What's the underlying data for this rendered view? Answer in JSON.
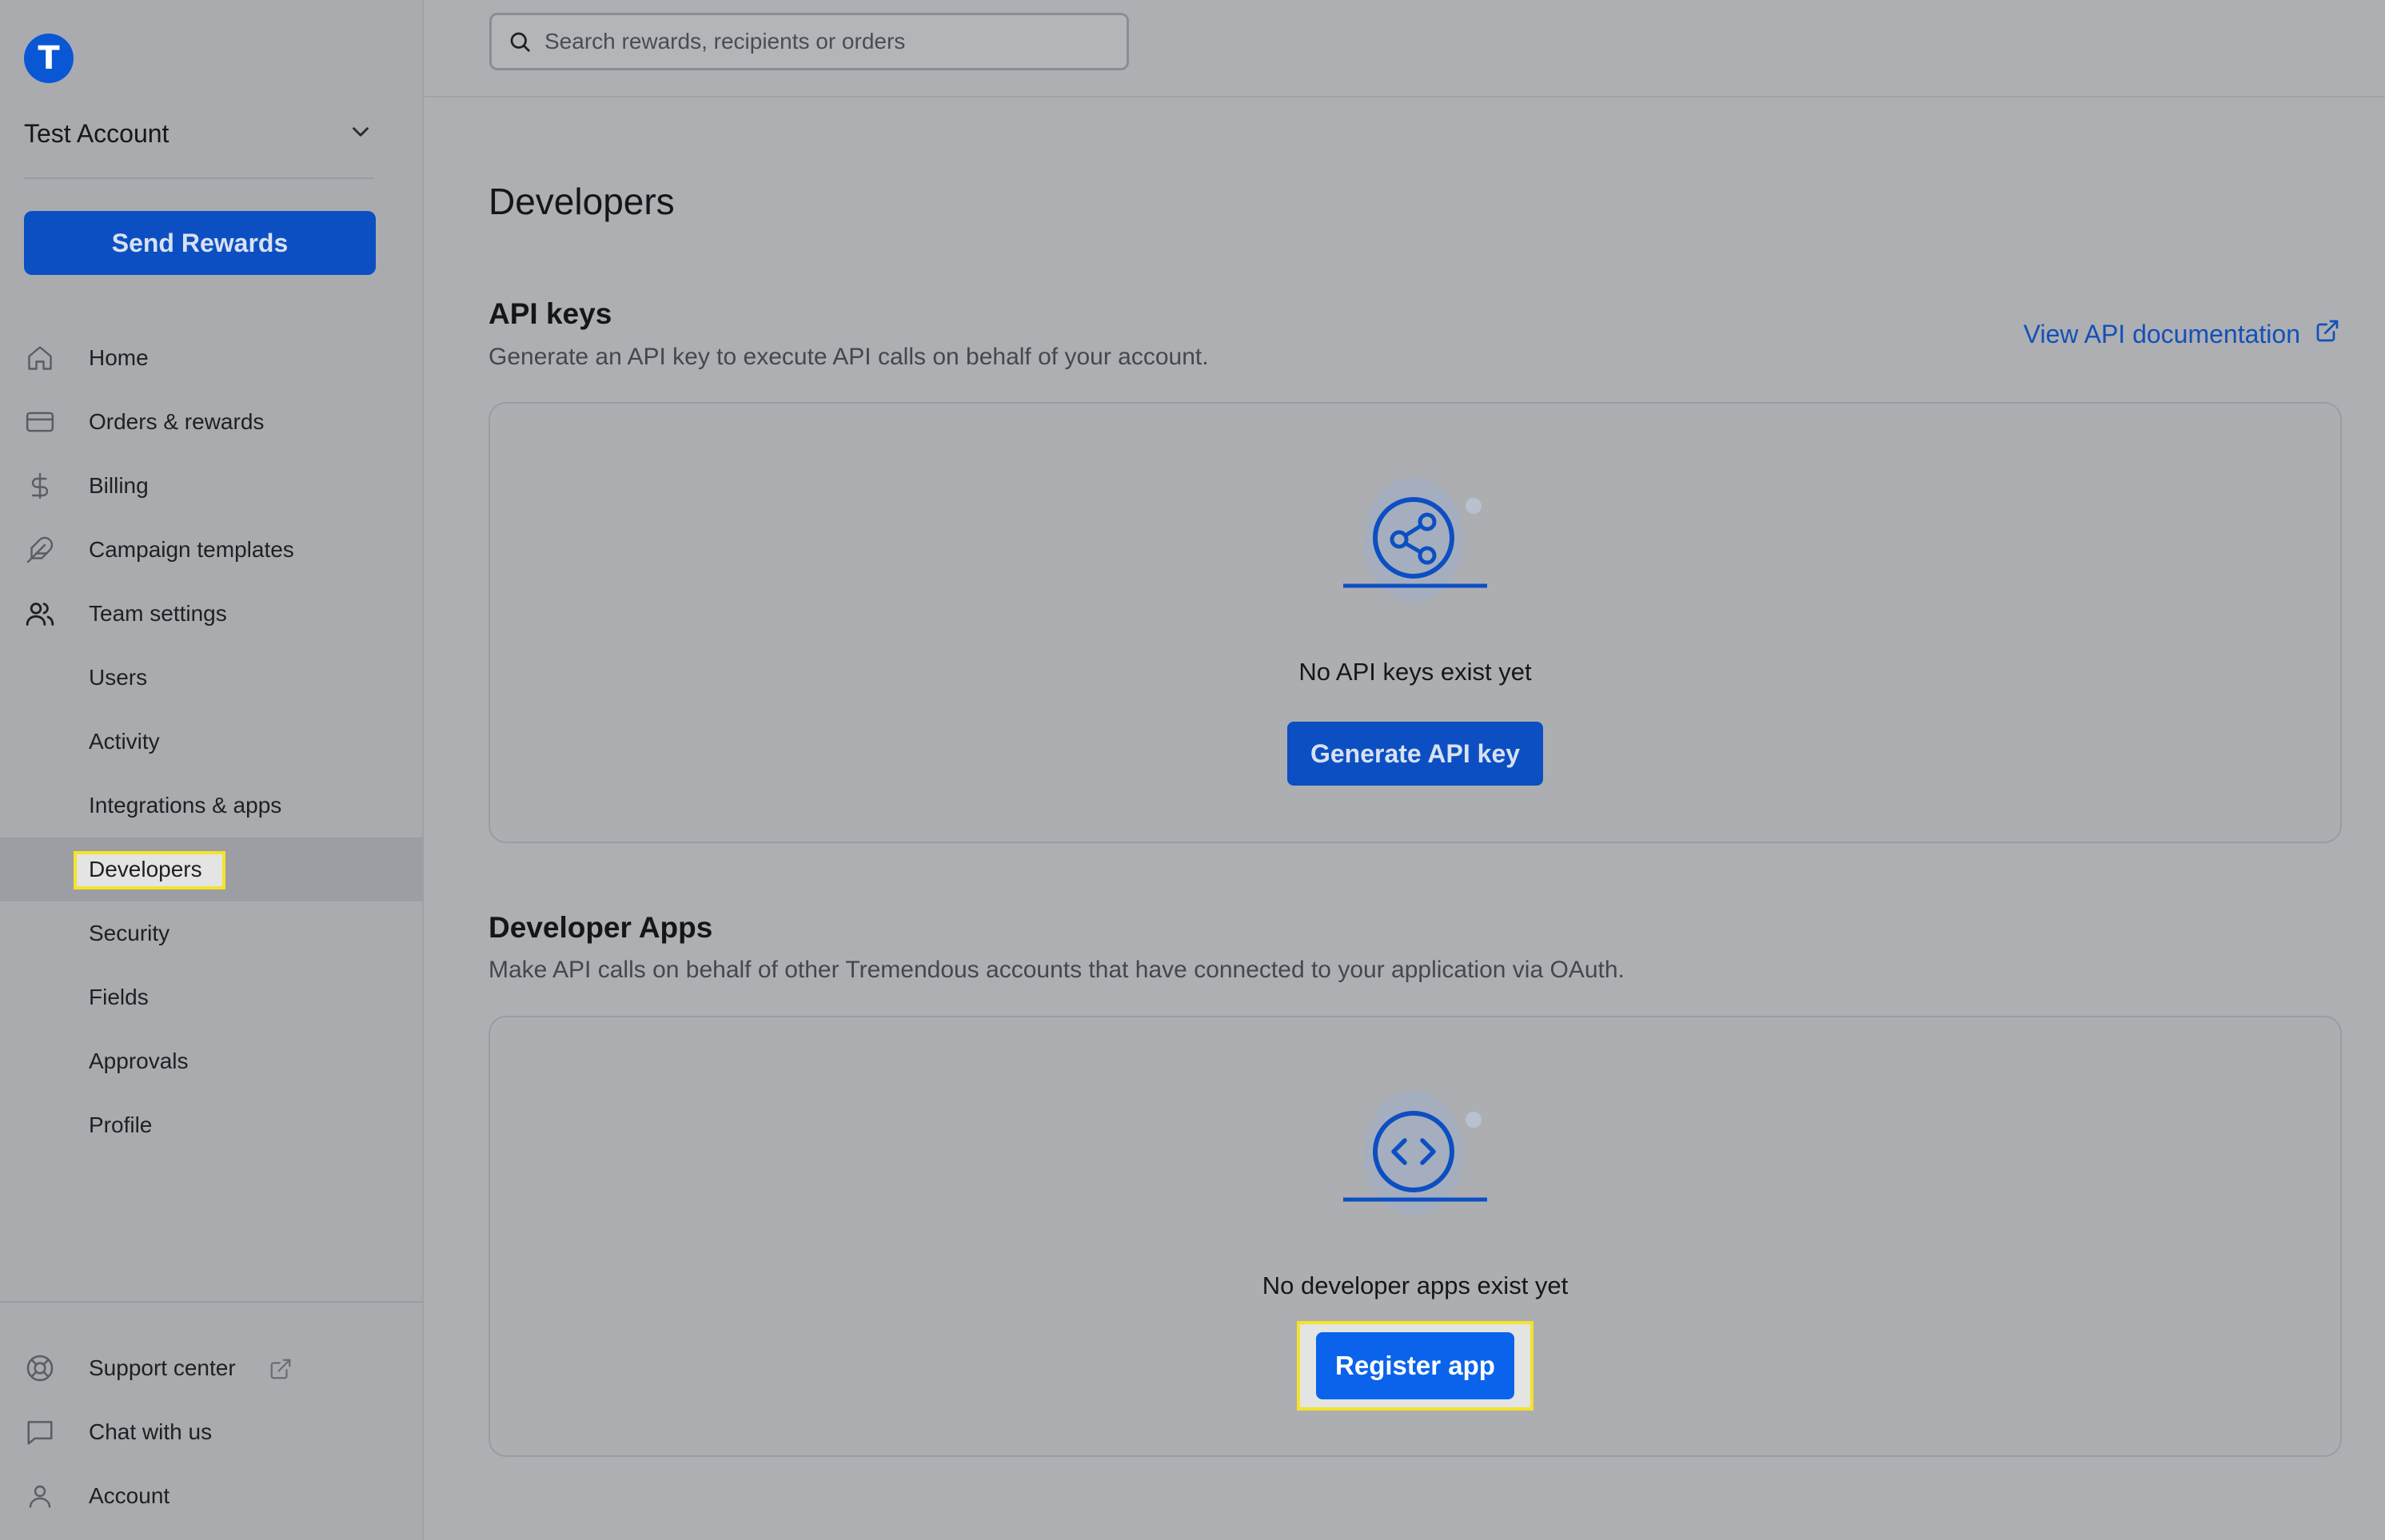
{
  "brand": {
    "logo_letter": "T"
  },
  "account": {
    "name": "Test Account"
  },
  "sidebar": {
    "send_label": "Send Rewards",
    "items": [
      {
        "label": "Home",
        "icon": "home-icon"
      },
      {
        "label": "Orders & rewards",
        "icon": "card-icon"
      },
      {
        "label": "Billing",
        "icon": "dollar-icon"
      },
      {
        "label": "Campaign templates",
        "icon": "feather-icon"
      },
      {
        "label": "Team settings",
        "icon": "users-icon"
      },
      {
        "label": "Users"
      },
      {
        "label": "Activity"
      },
      {
        "label": "Integrations & apps"
      },
      {
        "label": "Developers",
        "active": true
      },
      {
        "label": "Security"
      },
      {
        "label": "Fields"
      },
      {
        "label": "Approvals"
      },
      {
        "label": "Profile"
      }
    ],
    "bottom": [
      {
        "label": "Support center",
        "icon": "lifebuoy-icon",
        "external": true
      },
      {
        "label": "Chat with us",
        "icon": "chat-icon"
      },
      {
        "label": "Account",
        "icon": "person-icon"
      }
    ]
  },
  "search": {
    "placeholder": "Search rewards, recipients or orders"
  },
  "main": {
    "title": "Developers",
    "doc_link": "View API documentation",
    "api_keys": {
      "title": "API keys",
      "description": "Generate an API key to execute API calls on behalf of your account.",
      "empty_text": "No API keys exist yet",
      "button": "Generate API key"
    },
    "developer_apps": {
      "title": "Developer Apps",
      "description": "Make API calls on behalf of other Tremendous accounts that have connected to your application via OAuth.",
      "empty_text": "No developer apps exist yet",
      "button": "Register app"
    }
  },
  "colors": {
    "accent": "#0c4fc2",
    "register_button": "#0a63ea",
    "link": "#1450b8",
    "highlight": "#f4e32a"
  }
}
